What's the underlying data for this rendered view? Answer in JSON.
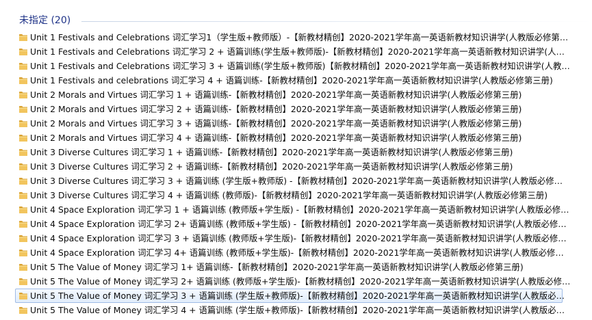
{
  "group": {
    "title": "未指定 (20)"
  },
  "icons": {
    "folder": "folder-icon",
    "folder_color": "#e8b64a"
  },
  "files": [
    {
      "name": " Unit 1 Festivals and Celebrations 词汇学习1（学生版+教师版）-【新教材精创】2020-2021学年高一英语新教材知识讲学(人教版必修第三册)"
    },
    {
      "name": "Unit 1 Festivals and Celebrations 词汇学习 2 + 语篇训练(学生版+教师版)-【新教材精创】2020-2021学年高一英语新教材知识讲学(人教版…"
    },
    {
      "name": "Unit 1 Festivals and Celebrations 词汇学习 3 + 语篇训练(学生版+教师版)【新教材精创】2020-2021学年高一英语新教材知识讲学(人教版必…"
    },
    {
      "name": "Unit 1 Festivals and celebrations 词汇学习 4 + 语篇训练-【新教材精创】2020-2021学年高一英语新教材知识讲学(人教版必修第三册)"
    },
    {
      "name": "Unit 2 Morals and Virtues 词汇学习 1 + 语篇训练-【新教材精创】2020-2021学年高一英语新教材知识讲学(人教版必修第三册)"
    },
    {
      "name": "Unit 2 Morals and Virtues 词汇学习 2 + 语篇训练-【新教材精创】2020-2021学年高一英语新教材知识讲学(人教版必修第三册)"
    },
    {
      "name": "Unit 2 Morals and Virtues 词汇学习 3 + 语篇训练-【新教材精创】2020-2021学年高一英语新教材知识讲学(人教版必修第三册)"
    },
    {
      "name": "Unit 2 Morals and Virtues 词汇学习 4 + 语篇训练-【新教材精创】2020-2021学年高一英语新教材知识讲学(人教版必修第三册)"
    },
    {
      "name": "Unit 3 Diverse Cultures 词汇学习 1 + 语篇训练-【新教材精创】2020-2021学年高一英语新教材知识讲学(人教版必修第三册)"
    },
    {
      "name": "Unit 3 Diverse Cultures 词汇学习 2 + 语篇训练-【新教材精创】2020-2021学年高一英语新教材知识讲学(人教版必修第三册)"
    },
    {
      "name": "Unit 3 Diverse Cultures 词汇学习 3 + 语篇训练 (学生版+教师版) -【新教材精创】2020-2021学年高一英语新教材知识讲学(人教版必修第三册)"
    },
    {
      "name": "Unit 3 Diverse Cultures 词汇学习 4 + 语篇训练 (教师版)-【新教材精创】2020-2021学年高一英语新教材知识讲学(人教版必修第三册)"
    },
    {
      "name": "Unit 4  Space Exploration 词汇学习 1 + 语篇训练 (教师版+学生版) -【新教材精创】2020-2021学年高一英语新教材知识讲学(人教版必修…"
    },
    {
      "name": "Unit 4  Space Exploration 词汇学习 2+ 语篇训练 (教师版+学生版) -【新教材精创】2020-2021学年高一英语新教材知识讲学(人教版必修第三…"
    },
    {
      "name": "Unit 4  Space Exploration 词汇学习 3 + 语篇训练 (教师版+学生版)-【新教材精创】2020-2021学年高一英语新教材知识讲学(人教版必修第三…"
    },
    {
      "name": "Unit 4  Space Exploration 词汇学习 4+ 语篇训练 (教师版+学生版)-【新教材精创】2020-2021学年高一英语新教材知识讲学(人教版必修第三…"
    },
    {
      "name": "Unit 5  The Value of Money 词汇学习 1+ 语篇训练-【新教材精创】2020-2021学年高一英语新教材知识讲学(人教版必修第三册)"
    },
    {
      "name": "Unit 5  The Value of Money 词汇学习 2+ 语篇训练 (教师版+学生版)-【新教材精创】2020-2021学年高一英语新教材知识讲学(人教版必修第…"
    },
    {
      "name": "Unit 5  The Value of Money 词汇学习 3 + 语篇训练 (学生版+教师版)-【新教材精创】2020-2021学年高一英语新教材知识讲学(人教版必修第…"
    },
    {
      "name": "Unit 5  The Value of Money 词汇学习 4 + 语篇训练 (学生版+教师版)-【新教材精创】2020-2021学年高一英语新教材知识讲学(人教版必修第…"
    }
  ]
}
